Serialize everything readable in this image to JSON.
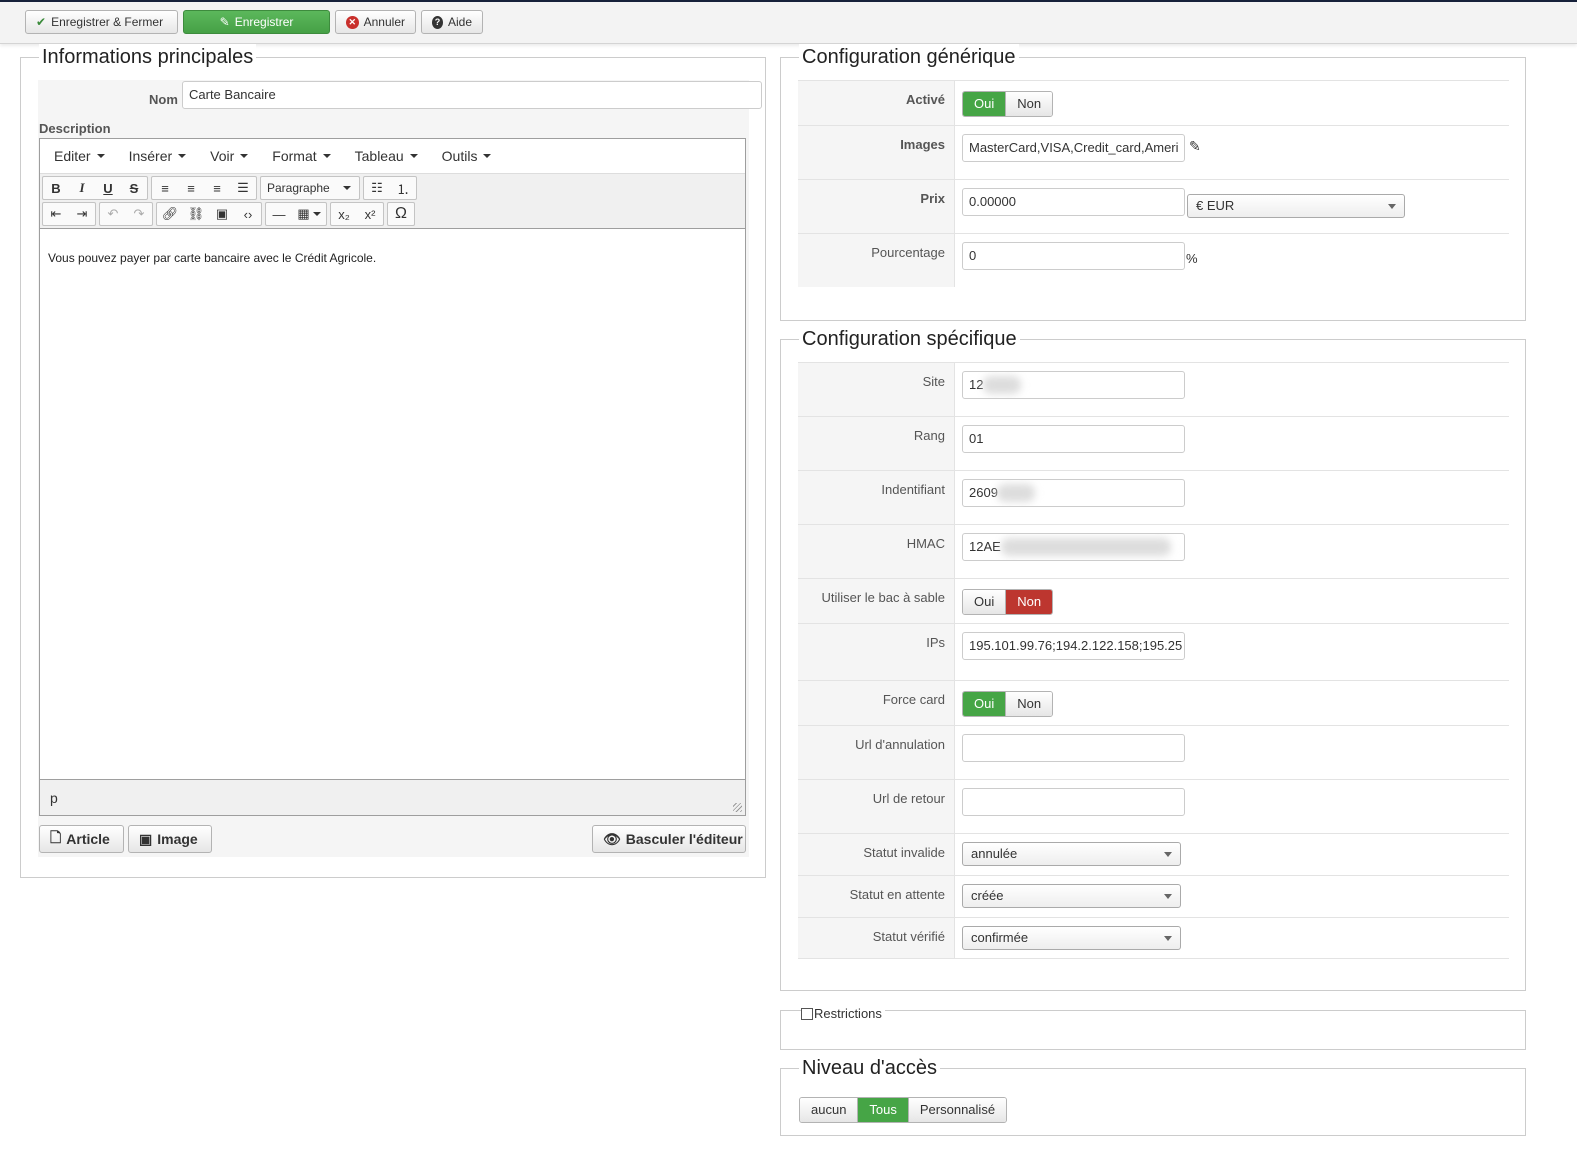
{
  "toolbar": {
    "save_close": "Enregistrer & Fermer",
    "save": "Enregistrer",
    "cancel": "Annuler",
    "help": "Aide"
  },
  "main_info": {
    "legend": "Informations principales",
    "name_label": "Nom",
    "name_value": "Carte Bancaire",
    "description_label": "Description",
    "editor": {
      "menu": [
        "Editer",
        "Insérer",
        "Voir",
        "Format",
        "Tableau",
        "Outils"
      ],
      "format_select": "Paragraphe",
      "content": "Vous pouvez payer par carte bancaire avec le Crédit Agricole.",
      "path": "p"
    },
    "btn_article": "Article",
    "btn_image": "Image",
    "btn_toggle_editor": "Basculer l'éditeur"
  },
  "generic": {
    "legend": "Configuration générique",
    "active_label": "Activé",
    "yes": "Oui",
    "no": "Non",
    "images_label": "Images",
    "images_value": "MasterCard,VISA,Credit_card,Ameri",
    "price_label": "Prix",
    "price_value": "0.00000",
    "currency": "€ EUR",
    "percent_label": "Pourcentage",
    "percent_value": "0",
    "percent_sign": "%"
  },
  "specific": {
    "legend": "Configuration spécifique",
    "site_label": "Site",
    "site_value": "12",
    "rang_label": "Rang",
    "rang_value": "01",
    "ident_label": "Indentifiant",
    "ident_value": "2609",
    "hmac_label": "HMAC",
    "hmac_value": "12AE",
    "sandbox_label": "Utiliser le bac à sable",
    "ips_label": "IPs",
    "ips_value": "195.101.99.76;194.2.122.158;195.25",
    "force_label": "Force card",
    "cancel_url_label": "Url d'annulation",
    "return_url_label": "Url de retour",
    "invalid_label": "Statut invalide",
    "invalid_value": "annulée",
    "pending_label": "Statut en attente",
    "pending_value": "créée",
    "verified_label": "Statut vérifié",
    "verified_value": "confirmée"
  },
  "restrictions": {
    "label": "Restrictions"
  },
  "access": {
    "legend": "Niveau d'accès",
    "options": [
      "aucun",
      "Tous",
      "Personnalisé"
    ],
    "selected": "Tous"
  },
  "colors": {
    "green": "#46a546",
    "red": "#bd362f"
  }
}
